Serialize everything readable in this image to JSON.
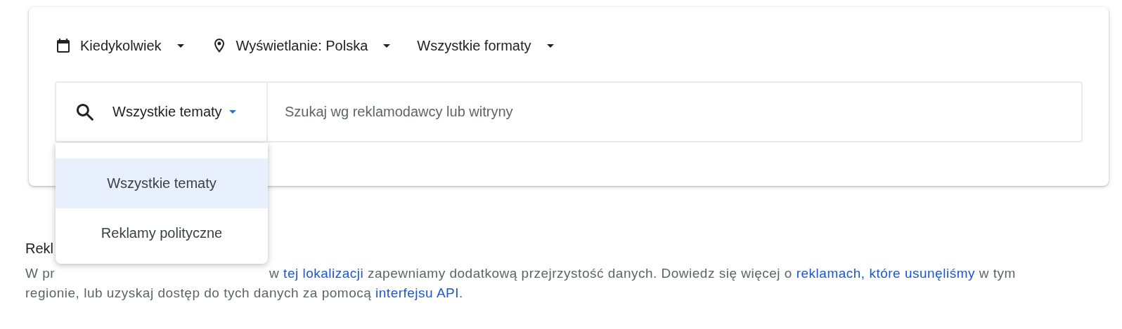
{
  "filters": [
    {
      "kind": "date",
      "label": "Kiedykolwiek"
    },
    {
      "kind": "location",
      "label": "Wyświetlanie: Polska"
    },
    {
      "kind": "plain",
      "label": "Wszystkie formaty"
    }
  ],
  "search": {
    "topic": "Wszystkie tematy",
    "expanded": true,
    "placeholder": "Szukaj wg reklamodawcy lub witryny"
  },
  "topic_menu": [
    {
      "label": "Wszystkie tematy",
      "selected": true
    },
    {
      "label": "Reklamy polityczne",
      "selected": false
    }
  ],
  "notice": {
    "heading": "Rekl",
    "lead": "W pr",
    "segments": [
      {
        "text": "w ",
        "link": false
      },
      {
        "text": "tej lokalizacji",
        "link": true
      },
      {
        "text": " zapewniamy dodatkową przejrzystość danych. Dowiedz się więcej o ",
        "link": false
      },
      {
        "text": "reklamach, które usunęliśmy",
        "link": true
      },
      {
        "text": " w tym regionie, lub uzyskaj dostęp do tych danych za pomocą ",
        "link": false
      },
      {
        "text": "interfejsu API",
        "link": true
      },
      {
        "text": ".",
        "link": false
      }
    ]
  }
}
